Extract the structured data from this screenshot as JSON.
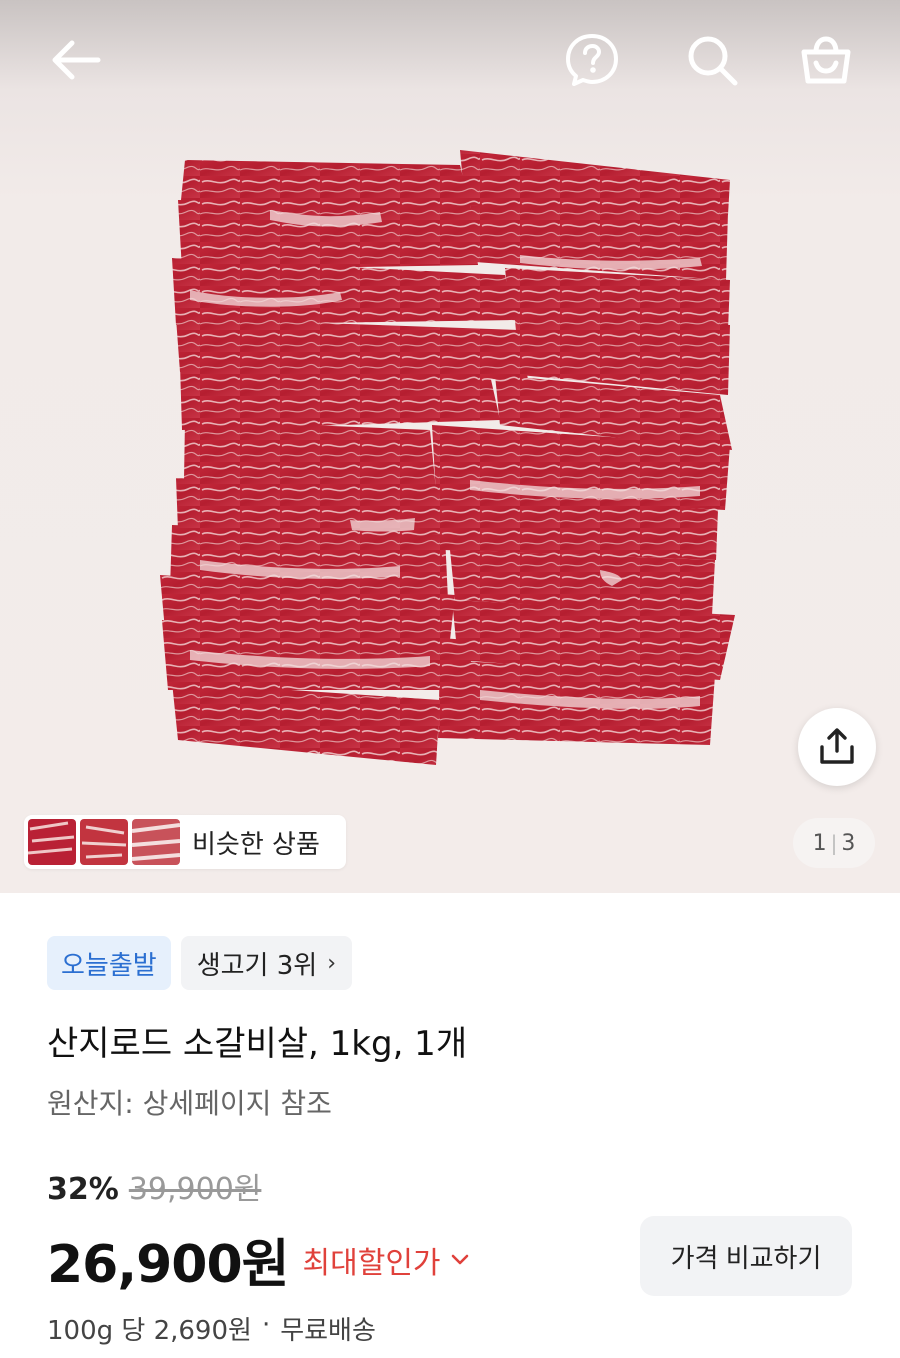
{
  "topbar": {
    "back_icon": "arrow-left-icon",
    "help_icon": "question-circle-icon",
    "search_icon": "search-icon",
    "cart_icon": "shopping-bag-icon"
  },
  "gallery": {
    "share_icon": "share-icon",
    "similar_label": "비슷한 상품",
    "page_current": "1",
    "page_total": "3"
  },
  "badges": {
    "today": "오늘출발",
    "rank": "생고기 3위",
    "rank_chevron": "›"
  },
  "product": {
    "title": "산지로드 소갈비살, 1kg, 1개",
    "origin": "원산지: 상세페이지 참조"
  },
  "pricing": {
    "discount_rate": "32%",
    "original_price": "39,900원",
    "sale_price": "26,900원",
    "max_discount_label": "최대할인가",
    "compare_button": "가격 비교하기",
    "unit_price": "100g 당 2,690원",
    "separator": "·",
    "shipping": "무료배송"
  },
  "colors": {
    "accent_red": "#e0413b",
    "badge_blue": "#2b6fd1",
    "badge_blue_bg": "#e6f0fc"
  }
}
